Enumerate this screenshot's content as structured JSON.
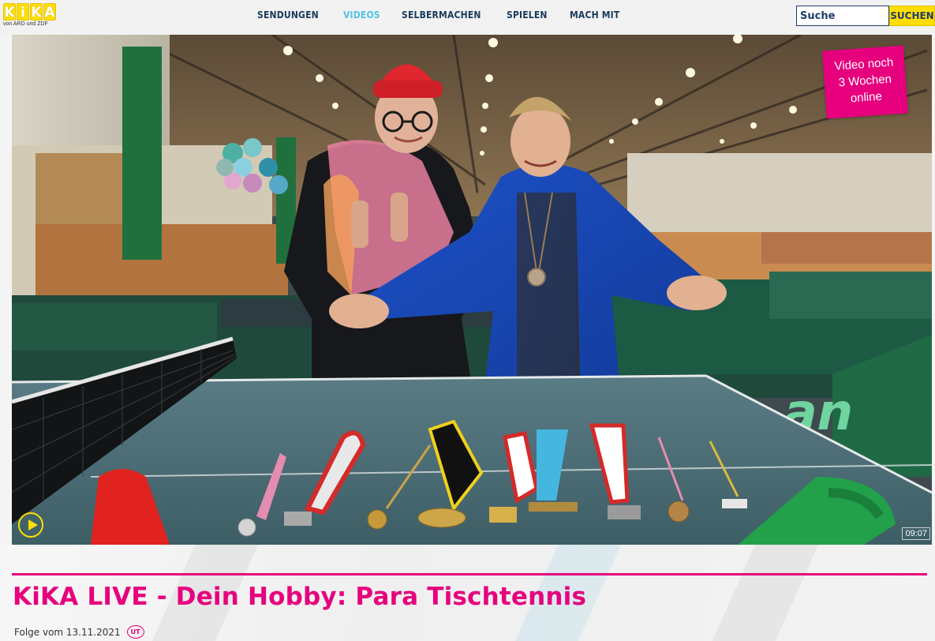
{
  "brand": {
    "logo_text": "KiKA",
    "logo_letters": [
      "K",
      "i",
      "K",
      "A"
    ],
    "sub_label": "von ARD und ZDF",
    "accent_yellow": "#ffde00",
    "accent_magenta": "#e6007e",
    "nav_active_color": "#4fc4e6"
  },
  "nav": {
    "items": [
      {
        "label": "SENDUNGEN",
        "active": false
      },
      {
        "label": "VIDEOS",
        "active": true
      },
      {
        "label": "SELBERMACHEN",
        "active": false
      },
      {
        "label": "SPIELEN",
        "active": false
      },
      {
        "label": "MACH MIT",
        "active": false
      }
    ]
  },
  "search": {
    "placeholder": "Suche",
    "button_label": "SUCHEN"
  },
  "video": {
    "availability_badge": [
      "Video noch",
      "3 Wochen",
      "online"
    ],
    "duration": "09:07",
    "play_icon": "play-circle-icon"
  },
  "episode": {
    "title": "KiKA LIVE - Dein Hobby: Para Tischtennis",
    "date_label": "Folge vom 13.11.2021",
    "subtitle_badge": "UT"
  }
}
